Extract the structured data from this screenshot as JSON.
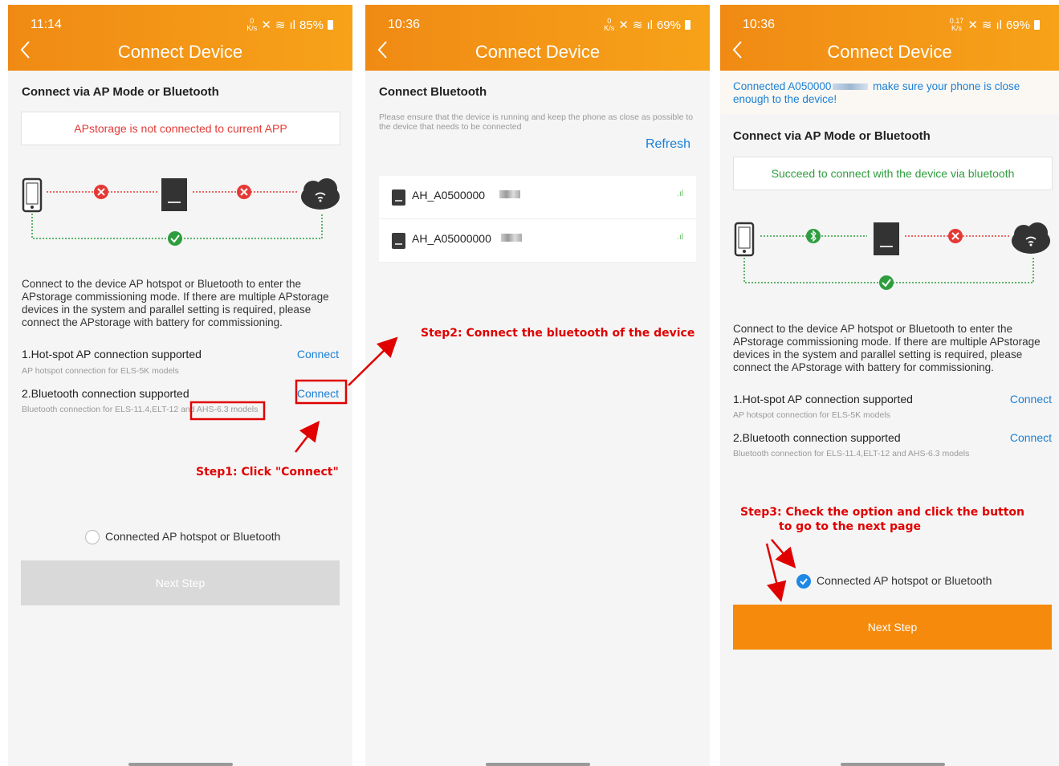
{
  "colors": {
    "header": "#f39214",
    "link": "#1a7fd6",
    "error": "#e53935",
    "success": "#2e9d3e",
    "accent": "#f58a0c",
    "annotation": "#e00000"
  },
  "screen1": {
    "time": "11:14",
    "status_data": "0\nK/s",
    "battery": "85%",
    "title": "Connect Device",
    "section_title": "Connect via AP Mode or Bluetooth",
    "status_message": "APstorage is not connected to current APP",
    "description": "Connect to the device AP hotspot or Bluetooth to enter the APstorage commissioning mode. If there are multiple APstorage devices in the system and parallel setting is required, please connect the APstorage with battery for commissioning.",
    "options": [
      {
        "label": "1.Hot-spot AP connection supported",
        "sub": "AP hotspot connection for ELS-5K models",
        "action": "Connect"
      },
      {
        "label": "2.Bluetooth connection supported",
        "sub": "Bluetooth connection for ELS-11.4,ELT-12 and AHS-6.3 models",
        "action": "Connect"
      }
    ],
    "checkbox_label": "Connected AP hotspot or Bluetooth",
    "next_button": "Next Step"
  },
  "screen2": {
    "time": "10:36",
    "status_data": "0\nK/s",
    "battery": "69%",
    "title": "Connect Device",
    "section_title": "Connect Bluetooth",
    "hint": "Please ensure that the device is running and keep the phone as close as possible to the device that needs to be connected",
    "refresh": "Refresh",
    "devices": [
      {
        "name": "AH_A0500000"
      },
      {
        "name": "AH_A05000000"
      }
    ]
  },
  "screen3": {
    "time": "10:36",
    "status_data": "0.17\nK/s",
    "battery": "69%",
    "title": "Connect Device",
    "notice": "Connected A050000",
    "notice_rest": " make sure your phone is close enough to the device!",
    "section_title": "Connect via AP Mode or Bluetooth",
    "status_message": "Succeed to connect with the device via bluetooth",
    "description": "Connect to the device AP hotspot or Bluetooth to enter the APstorage commissioning mode. If there are multiple APstorage devices in the system and parallel setting is required, please connect the APstorage with battery for commissioning.",
    "options": [
      {
        "label": "1.Hot-spot AP connection supported",
        "sub": "AP hotspot connection for ELS-5K models",
        "action": "Connect"
      },
      {
        "label": "2.Bluetooth connection supported",
        "sub": "Bluetooth connection for ELS-11.4,ELT-12 and AHS-6.3 models",
        "action": "Connect"
      }
    ],
    "checkbox_label": "Connected AP hotspot or Bluetooth",
    "checkbox_checked": true,
    "next_button": "Next Step"
  },
  "annotations": {
    "step1": "Step1: Click \"Connect\"",
    "step2": "Step2: Connect the bluetooth of the device",
    "step3_line1": "Step3: Check the option and click the button",
    "step3_line2": "to go to the next page"
  }
}
